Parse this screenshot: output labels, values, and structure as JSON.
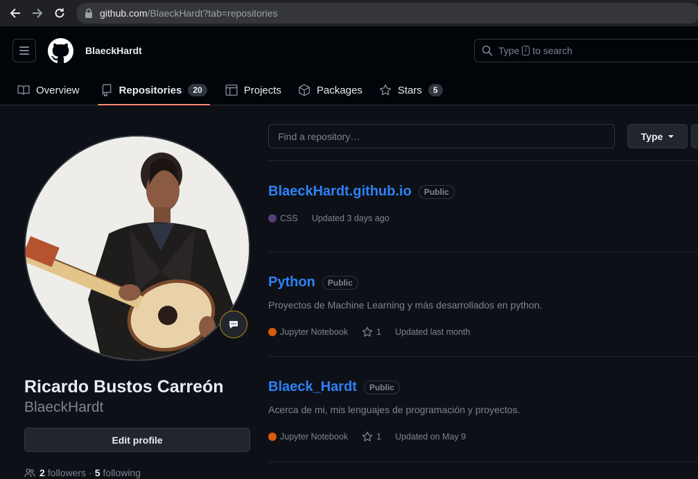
{
  "browser": {
    "url_host": "github.com",
    "url_path": "/BlaeckHardt?tab=repositories"
  },
  "header": {
    "username": "BlaeckHardt",
    "search_prefix": "Type",
    "search_key": "/",
    "search_suffix": "to search"
  },
  "tabs": [
    {
      "label": "Overview",
      "icon": "book-icon",
      "count": null
    },
    {
      "label": "Repositories",
      "icon": "repo-icon",
      "count": "20",
      "selected": true
    },
    {
      "label": "Projects",
      "icon": "table-icon",
      "count": null
    },
    {
      "label": "Packages",
      "icon": "package-icon",
      "count": null
    },
    {
      "label": "Stars",
      "icon": "star-icon",
      "count": "5"
    }
  ],
  "profile": {
    "name": "Ricardo Bustos Carreón",
    "login": "BlaeckHardt",
    "edit_label": "Edit profile",
    "followers_count": "2",
    "followers_label": "followers",
    "separator": "·",
    "following_count": "5",
    "following_label": "following"
  },
  "filters": {
    "find_placeholder": "Find a repository…",
    "type_label": "Type"
  },
  "repos": [
    {
      "name": "BlaeckHardt.github.io",
      "visibility": "Public",
      "description": "",
      "language": "CSS",
      "language_color": "#563d7c",
      "stars": "",
      "updated": "Updated 3 days ago"
    },
    {
      "name": "Python",
      "visibility": "Public",
      "description": "Proyectos de Machine Learning y más desarrollados en python.",
      "language": "Jupyter Notebook",
      "language_color": "#DA5B0B",
      "stars": "1",
      "updated": "Updated last month"
    },
    {
      "name": "Blaeck_Hardt",
      "visibility": "Public",
      "description": "Acerca de mi, mis lenguajes de programación y proyectos.",
      "language": "Jupyter Notebook",
      "language_color": "#DA5B0B",
      "stars": "1",
      "updated": "Updated on May 9"
    }
  ],
  "colors": {
    "accent_link": "#2f81f7",
    "tab_underline": "#fd8c73",
    "background": "#0d1117"
  }
}
